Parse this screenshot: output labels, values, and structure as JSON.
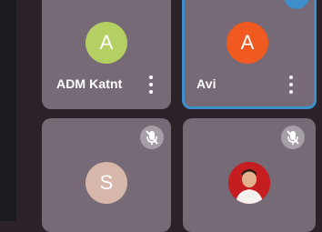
{
  "participants": [
    {
      "name": "ADM Katnt",
      "initial": "A",
      "avatar_color": "#b4cf62",
      "muted": false
    },
    {
      "name": "Avi",
      "initial": "A",
      "avatar_color": "#f05a20",
      "muted": false,
      "active_speaker": true
    },
    {
      "name": "",
      "initial": "S",
      "avatar_color": "#d6b7aa",
      "muted": true
    },
    {
      "name": "",
      "initial": "",
      "avatar_color": "#c61d20",
      "muted": true,
      "has_photo": true
    }
  ],
  "colors": {
    "background": "#2b2128",
    "tile": "#776a77",
    "speaker_highlight": "#3d8ec9"
  }
}
